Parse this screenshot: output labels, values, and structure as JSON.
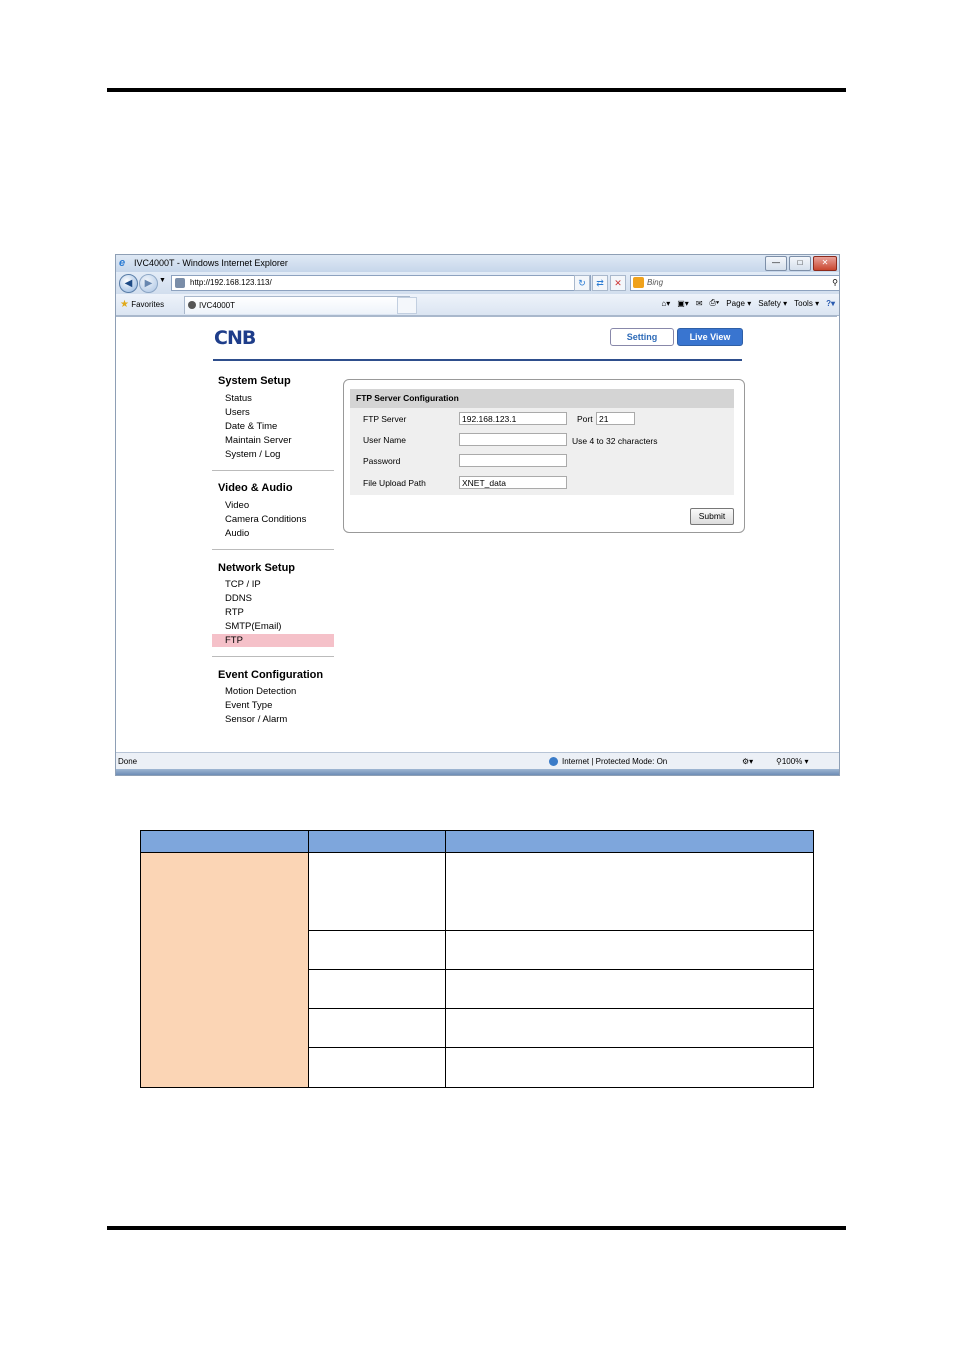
{
  "browser": {
    "title": "IVC4000T - Windows Internet Explorer",
    "address": "http://192.168.123.113/",
    "search_placeholder": "Bing",
    "favorites_label": "Favorites",
    "tab_label": "IVC4000T",
    "cmd": {
      "page": "Page",
      "safety": "Safety",
      "tools": "Tools"
    },
    "status_left": "Done",
    "status_zone": "Internet | Protected Mode: On",
    "zoom": "100%"
  },
  "app": {
    "logo": "CNB",
    "setting_button": "Setting",
    "live_view_button": "Live View"
  },
  "menu": {
    "system_setup": {
      "title": "System Setup",
      "items": [
        "Status",
        "Users",
        "Date & Time",
        "Maintain Server",
        "System / Log"
      ]
    },
    "video_audio": {
      "title": "Video & Audio",
      "items": [
        "Video",
        "Camera Conditions",
        "Audio"
      ]
    },
    "network_setup": {
      "title": "Network Setup",
      "items": [
        "TCP / IP",
        "DDNS",
        "RTP",
        "SMTP(Email)",
        "FTP"
      ]
    },
    "event_config": {
      "title": "Event Configuration",
      "items": [
        "Motion Detection",
        "Event Type",
        "Sensor / Alarm"
      ]
    },
    "selected": "FTP"
  },
  "ftp": {
    "header": "FTP Server Configuration",
    "server_label": "FTP Server",
    "server_value": "192.168.123.1",
    "port_label": "Port",
    "port_value": "21",
    "username_label": "User Name",
    "username_value": "",
    "username_hint": "Use 4 to 32 characters",
    "password_label": "Password",
    "password_value": "",
    "path_label": "File Upload Path",
    "path_value": "XNET_data",
    "submit_label": "Submit"
  },
  "colors": {
    "table_header": "#7ea6dc",
    "table_peach": "#fbd5b5",
    "menu_highlight": "#f5c1c9",
    "live_view": "#3975d0"
  }
}
